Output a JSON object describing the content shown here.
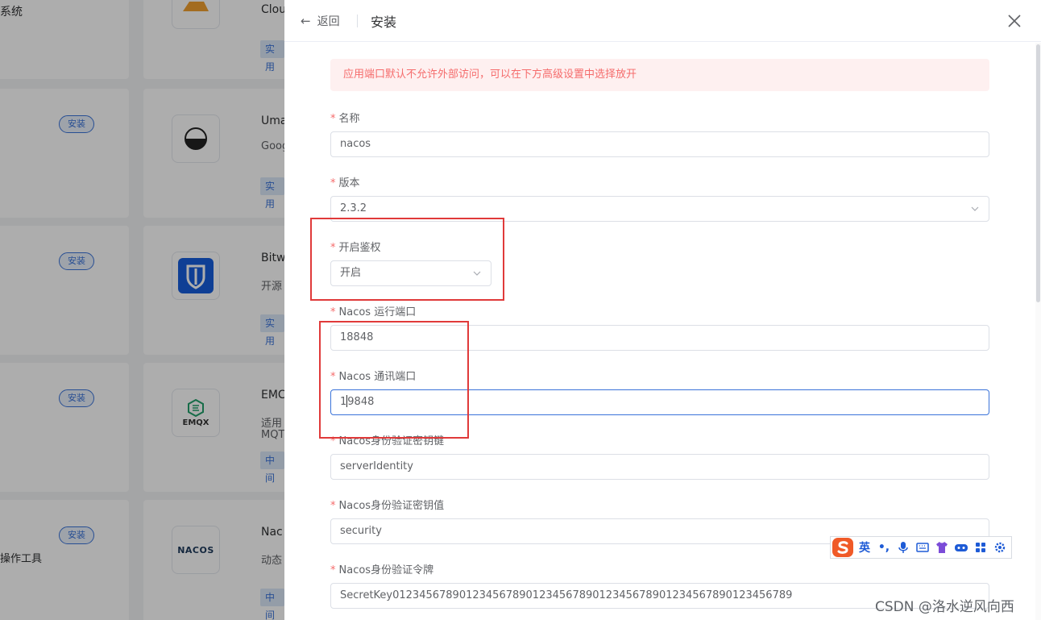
{
  "background": {
    "cards": [
      {
        "left_text": "系统",
        "name": "Clou",
        "desc": "",
        "tag": "实用",
        "install": ""
      },
      {
        "left_text": "",
        "name": "Uma",
        "desc": "Goog",
        "tag": "实用",
        "install": "安装"
      },
      {
        "left_text": "",
        "name": "Bitw",
        "desc": "开源",
        "tag": "实用",
        "install": "安装"
      },
      {
        "left_text": "",
        "name": "EMC",
        "desc": "适用",
        "desc2": "MQT",
        "tag": "中间",
        "install": "安装",
        "icon_label": "EMQX"
      },
      {
        "left_text": "操作工具",
        "name": "Nac",
        "desc": "动态",
        "tag": "中间",
        "install": "安装",
        "icon_label": "NACOS"
      }
    ]
  },
  "drawer": {
    "back_label": "返回",
    "title": "安装",
    "alert": "应用端口默认不允许外部访问，可以在下方高级设置中选择放开",
    "fields": {
      "name": {
        "label": "名称",
        "value": "nacos"
      },
      "version": {
        "label": "版本",
        "value": "2.3.2"
      },
      "auth": {
        "label": "开启鉴权",
        "value": "开启"
      },
      "run_port": {
        "label": "Nacos 运行端口",
        "value": "18848"
      },
      "comm_port": {
        "label": "Nacos 通讯端口",
        "value_before_caret": "1",
        "value_after_caret": "9848"
      },
      "identity_key": {
        "label": "Nacos身份验证密钥键",
        "value": "serverIdentity"
      },
      "identity_value": {
        "label": "Nacos身份验证密钥值",
        "value": "security"
      },
      "token": {
        "label": "Nacos身份验证令牌",
        "value": "SecretKey012345678901234567890123456789012345678901234567890123456789"
      }
    }
  },
  "ime": {
    "items": [
      "英",
      "•,",
      "mic-icon",
      "keyboard-icon",
      "skin-icon",
      "game-icon",
      "apps-icon",
      "settings-icon"
    ],
    "lang_label": "英",
    "punct_label": "•,"
  },
  "watermark": "CSDN @洛水逆风向西",
  "colors": {
    "accent": "#3a73d9",
    "danger": "#f56c6c",
    "highlight_box": "#e03a3a"
  }
}
